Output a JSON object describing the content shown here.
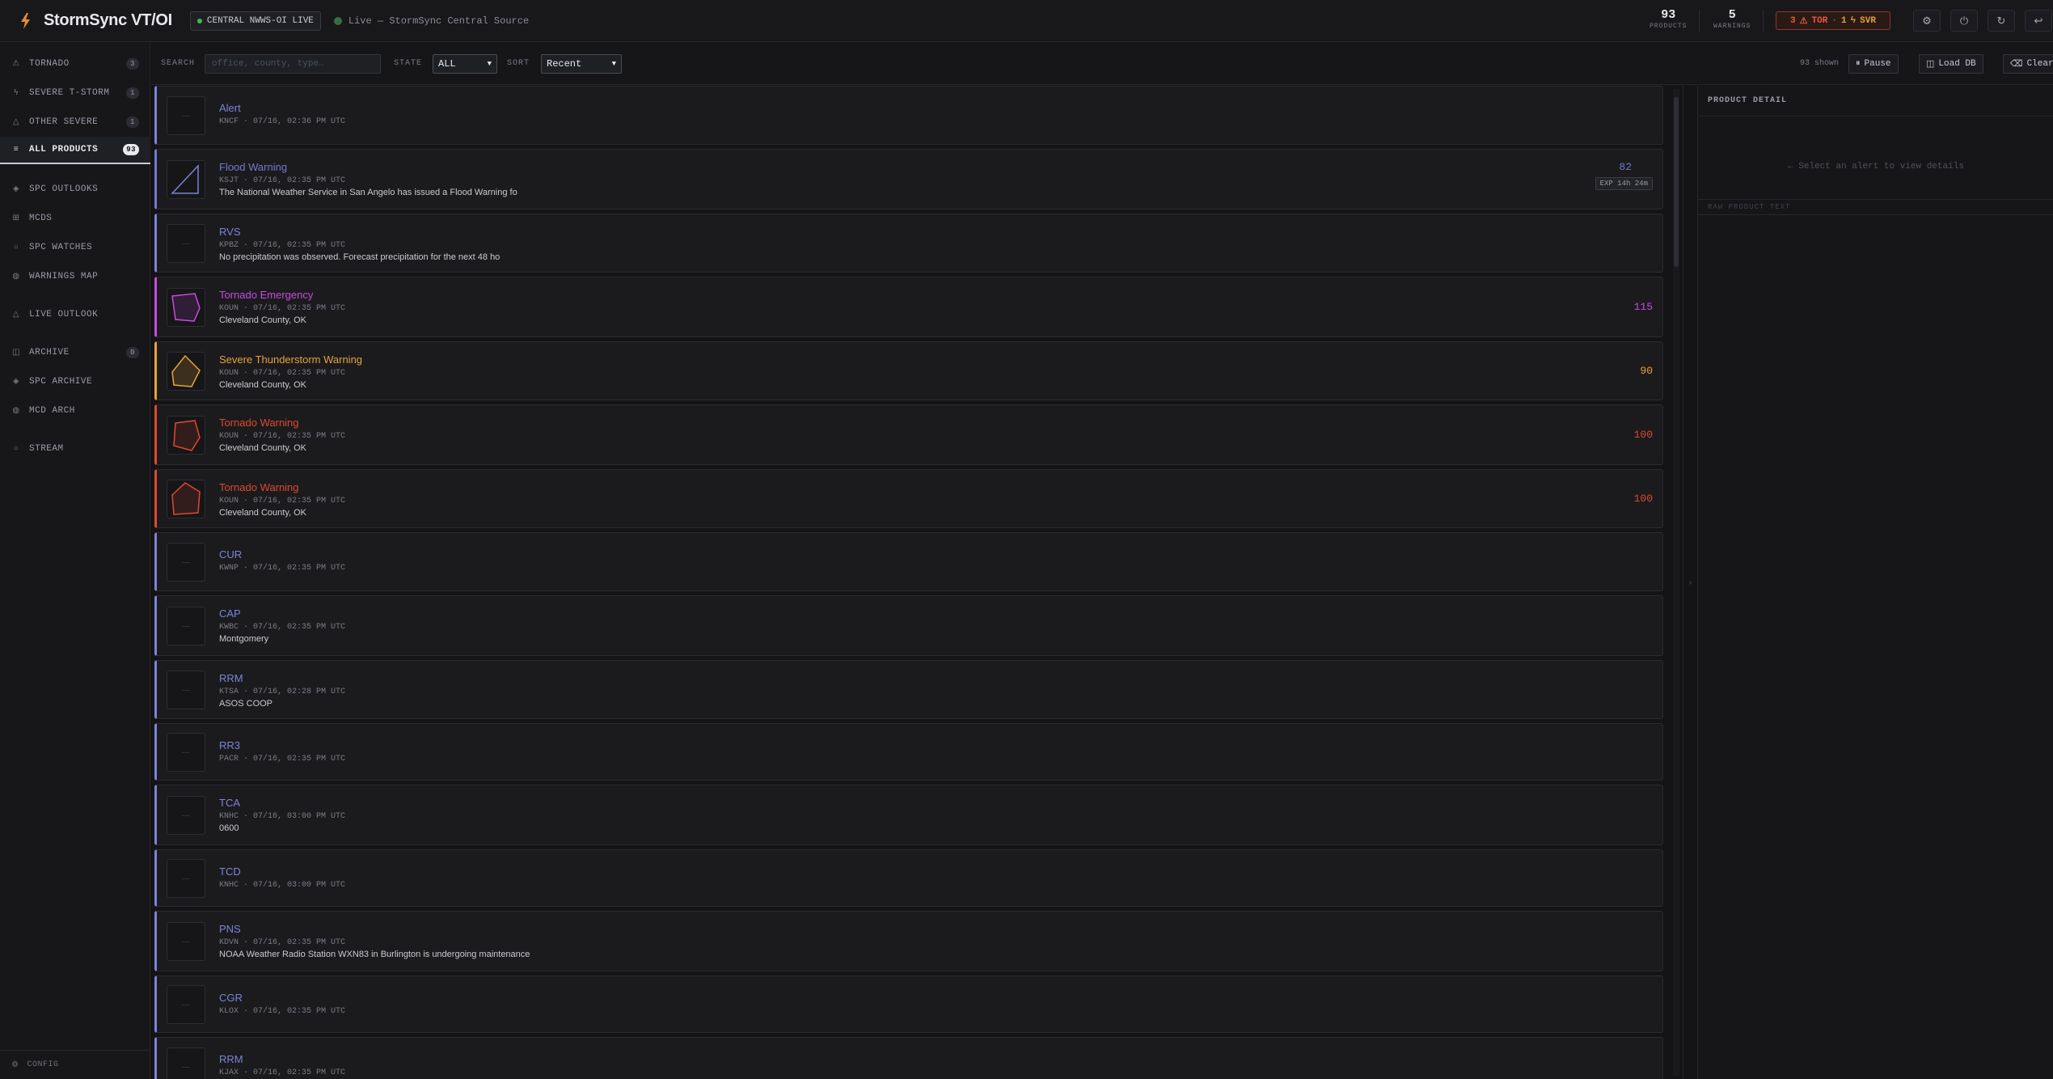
{
  "app": {
    "title": "StormSync VT/OI"
  },
  "header": {
    "live_chip": "CENTRAL NWWS-OI LIVE",
    "source": "Live — StormSync Central Source",
    "products_count": "93",
    "products_label": "PRODUCTS",
    "warnings_count": "5",
    "warnings_label": "WARNINGS",
    "tor_count": "3",
    "tor_label": "TOR",
    "svr_count": "1",
    "svr_label": "SVR"
  },
  "sidebar": {
    "items": [
      {
        "label": "TORNADO",
        "badge": "3",
        "icon": "triangle-icon"
      },
      {
        "label": "SEVERE T-STORM",
        "badge": "1",
        "icon": "bolt-icon"
      },
      {
        "label": "OTHER SEVERE",
        "badge": "1",
        "icon": "alert-icon"
      },
      {
        "label": "ALL PRODUCTS",
        "badge": "93",
        "icon": "list-icon"
      },
      {
        "label": "SPC OUTLOOKS",
        "badge": "",
        "icon": "diamond-icon"
      },
      {
        "label": "MCDS",
        "badge": "",
        "icon": "grid-icon"
      },
      {
        "label": "SPC WATCHES",
        "badge": "",
        "icon": "circle-icon"
      },
      {
        "label": "WARNINGS MAP",
        "badge": "",
        "icon": "globe-icon"
      },
      {
        "label": "LIVE OUTLOOK",
        "badge": "",
        "icon": "triangle-outline-icon"
      },
      {
        "label": "ARCHIVE",
        "badge": "0",
        "icon": "archive-icon"
      },
      {
        "label": "SPC ARCHIVE",
        "badge": "",
        "icon": "diamond-icon"
      },
      {
        "label": "MCD ARCH",
        "badge": "",
        "icon": "globe-icon"
      },
      {
        "label": "STREAM",
        "badge": "",
        "icon": "circle-icon"
      }
    ],
    "config_label": "CONFIG"
  },
  "toolbar": {
    "search_label": "SEARCH",
    "search_placeholder": "office, county, type…",
    "state_label": "STATE",
    "state_value": "ALL",
    "sort_label": "SORT",
    "sort_value": "Recent",
    "shown_text": "93 shown",
    "pause_label": "Pause",
    "load_db_label": "Load DB",
    "clear_label": "Clear"
  },
  "products": [
    {
      "title": "Alert",
      "meta": "KNCF · 07/16, 02:36 PM UTC",
      "desc": "",
      "num": "",
      "exp": "",
      "color": "#7b84d8",
      "shape": "none"
    },
    {
      "title": "Flood Warning",
      "meta": "KSJT · 07/16, 02:35 PM UTC",
      "desc": "The National Weather Service in San Angelo has issued a Flood Warning fo",
      "num": "82",
      "exp": "EXP 14h 24m",
      "color": "#6f7bd0",
      "shape": "flood"
    },
    {
      "title": "RVS",
      "meta": "KPBZ · 07/16, 02:35 PM UTC",
      "desc": "No precipitation was observed. Forecast precipitation for the next 48 ho",
      "num": "",
      "exp": "",
      "color": "#7b84d8",
      "shape": "none"
    },
    {
      "title": "Tornado Emergency",
      "meta": "KOUN · 07/16, 02:35 PM UTC",
      "desc": "Cleveland County, OK",
      "num": "115",
      "exp": "",
      "color": "#c94be0",
      "shape": "poly1"
    },
    {
      "title": "Severe Thunderstorm Warning",
      "meta": "KOUN · 07/16, 02:35 PM UTC",
      "desc": "Cleveland County, OK",
      "num": "90",
      "exp": "",
      "color": "#e8a23a",
      "shape": "poly2"
    },
    {
      "title": "Tornado Warning",
      "meta": "KOUN · 07/16, 02:35 PM UTC",
      "desc": "Cleveland County, OK",
      "num": "100",
      "exp": "",
      "color": "#e0492e",
      "shape": "poly3"
    },
    {
      "title": "Tornado Warning",
      "meta": "KOUN · 07/16, 02:35 PM UTC",
      "desc": "Cleveland County, OK",
      "num": "100",
      "exp": "",
      "color": "#e0492e",
      "shape": "poly4"
    },
    {
      "title": "CUR",
      "meta": "KWNP · 07/16, 02:35 PM UTC",
      "desc": "",
      "num": "",
      "exp": "",
      "color": "#7b84d8",
      "shape": "none"
    },
    {
      "title": "CAP",
      "meta": "KWBC · 07/16, 02:35 PM UTC",
      "desc": "Montgomery",
      "num": "",
      "exp": "",
      "color": "#7b84d8",
      "shape": "none"
    },
    {
      "title": "RRM",
      "meta": "KTSA · 07/16, 02:28 PM UTC",
      "desc": "ASOS COOP",
      "num": "",
      "exp": "",
      "color": "#7b84d8",
      "shape": "none"
    },
    {
      "title": "RR3",
      "meta": "PACR · 07/16, 02:35 PM UTC",
      "desc": "",
      "num": "",
      "exp": "",
      "color": "#7b84d8",
      "shape": "none"
    },
    {
      "title": "TCA",
      "meta": "KNHC · 07/16, 03:00 PM UTC",
      "desc": "0600",
      "num": "",
      "exp": "",
      "color": "#7b84d8",
      "shape": "none"
    },
    {
      "title": "TCD",
      "meta": "KNHC · 07/16, 03:00 PM UTC",
      "desc": "",
      "num": "",
      "exp": "",
      "color": "#7b84d8",
      "shape": "none"
    },
    {
      "title": "PNS",
      "meta": "KDVN · 07/16, 02:35 PM UTC",
      "desc": "NOAA Weather Radio Station WXN83 in Burlington is undergoing maintenance",
      "num": "",
      "exp": "",
      "color": "#7b84d8",
      "shape": "none"
    },
    {
      "title": "CGR",
      "meta": "KLOX · 07/16, 02:35 PM UTC",
      "desc": "",
      "num": "",
      "exp": "",
      "color": "#7b84d8",
      "shape": "none"
    },
    {
      "title": "RRM",
      "meta": "KJAX · 07/16, 02:35 PM UTC",
      "desc": "",
      "num": "",
      "exp": "",
      "color": "#7b84d8",
      "shape": "none"
    }
  ],
  "detail": {
    "title": "PRODUCT DETAIL",
    "empty_text": "← Select an alert to view details",
    "raw_label": "RAW PRODUCT TEXT"
  }
}
